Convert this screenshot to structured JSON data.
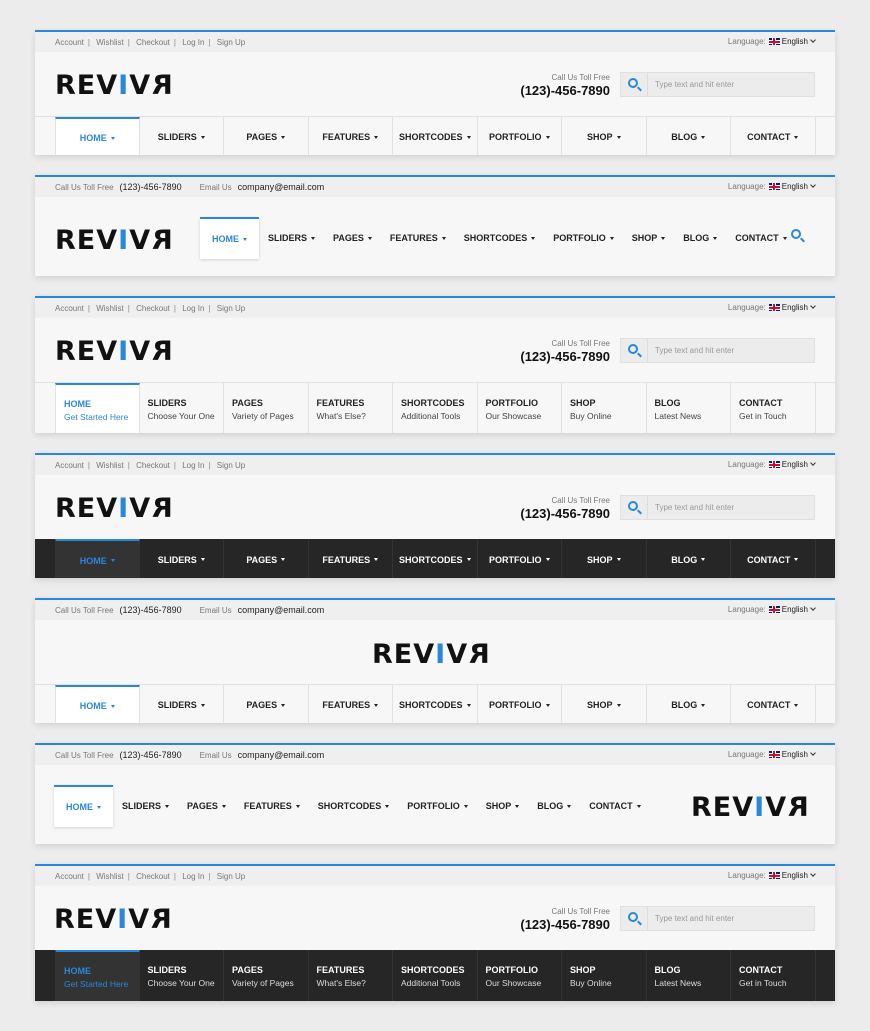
{
  "colors": {
    "accent": "#2b87da",
    "dark_nav": "#262626"
  },
  "logo": {
    "pre": "REV",
    "mid": "I",
    "post": "V",
    "mirror": "R"
  },
  "topbar_links": [
    "Account",
    "Wishlist",
    "Checkout",
    "Log In",
    "Sign Up"
  ],
  "contact": {
    "call_label": "Call Us Toll Free",
    "phone": "(123)-456-7890",
    "email_label": "Email Us",
    "email": "company@email.com"
  },
  "language": {
    "label": "Language:",
    "value": "English"
  },
  "header_call": {
    "label": "Call Us Toll Free",
    "phone": "(123)-456-7890"
  },
  "search": {
    "placeholder": "Type text and hit enter",
    "icon": "search-icon"
  },
  "menu": [
    "HOME",
    "SLIDERS",
    "PAGES",
    "FEATURES",
    "SHORTCODES",
    "PORTFOLIO",
    "SHOP",
    "BLOG",
    "CONTACT"
  ],
  "menu_subtitles": [
    "Get Started Here",
    "Choose Your One",
    "Variety of Pages",
    "What's Else?",
    "Additional Tools",
    "Our Showcase",
    "Buy Online",
    "Latest News",
    "Get in Touch"
  ]
}
